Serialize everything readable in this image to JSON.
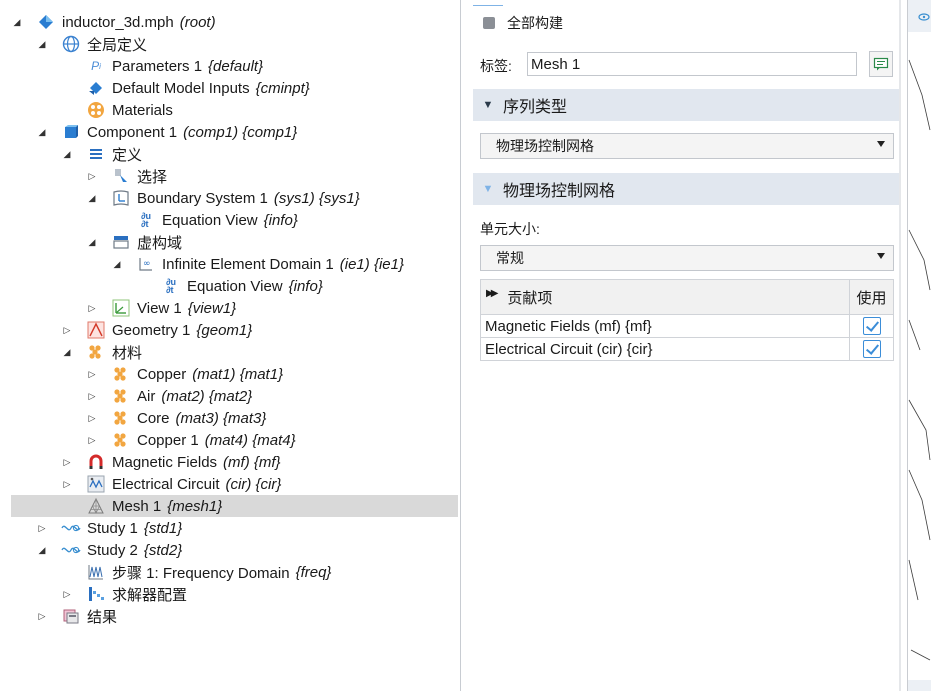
{
  "tree": {
    "root": {
      "label": "inductor_3d.mph",
      "tag": "(root)"
    },
    "global_defs": {
      "label": "全局定义"
    },
    "parameters": {
      "label": "Parameters 1",
      "tag": "{default}"
    },
    "default_model_inputs": {
      "label": "Default Model Inputs",
      "tag": "{cminpt}"
    },
    "materials_global": {
      "label": "Materials"
    },
    "component": {
      "label": "Component 1",
      "tag": "(comp1) {comp1}"
    },
    "definitions": {
      "label": "定义"
    },
    "selections": {
      "label": "选择"
    },
    "boundary_system": {
      "label": "Boundary System 1",
      "tag": "(sys1) {sys1}"
    },
    "equation_view_1": {
      "label": "Equation View",
      "tag": "{info}"
    },
    "virtual_domain": {
      "label": "虚构域"
    },
    "infinite_element": {
      "label": "Infinite Element Domain 1",
      "tag": "(ie1) {ie1}"
    },
    "equation_view_2": {
      "label": "Equation View",
      "tag": "{info}"
    },
    "view": {
      "label": "View 1",
      "tag": "{view1}"
    },
    "geometry": {
      "label": "Geometry 1",
      "tag": "{geom1}"
    },
    "materials": {
      "label": "材料"
    },
    "mat1": {
      "label": "Copper",
      "tag": "(mat1) {mat1}"
    },
    "mat2": {
      "label": "Air",
      "tag": "(mat2) {mat2}"
    },
    "mat3": {
      "label": "Core",
      "tag": "(mat3) {mat3}"
    },
    "mat4": {
      "label": "Copper 1",
      "tag": "(mat4) {mat4}"
    },
    "mf": {
      "label": "Magnetic Fields",
      "tag": "(mf) {mf}"
    },
    "cir": {
      "label": "Electrical Circuit",
      "tag": "(cir) {cir}"
    },
    "mesh": {
      "label": "Mesh 1",
      "tag": "{mesh1}"
    },
    "study1": {
      "label": "Study 1",
      "tag": "{std1}"
    },
    "study2": {
      "label": "Study 2",
      "tag": "{std2}"
    },
    "step1": {
      "label": "步骤 1: Frequency Domain",
      "tag": "{freq}"
    },
    "solver": {
      "label": "求解器配置"
    },
    "results": {
      "label": "结果"
    }
  },
  "settings": {
    "build_all_label": "全部构建",
    "label_caption": "标签:",
    "label_value": "Mesh 1",
    "sequence_type_header": "序列类型",
    "sequence_type_value": "物理场控制网格",
    "physics_mesh_header": "物理场控制网格",
    "element_size_label": "单元大小:",
    "element_size_value": "常规",
    "table": {
      "col_contrib": "贡献项",
      "col_use": "使用",
      "rows": [
        {
          "name": "Magnetic Fields (mf) {mf}",
          "use": true
        },
        {
          "name": "Electrical Circuit (cir) {cir}",
          "use": true
        }
      ]
    }
  }
}
